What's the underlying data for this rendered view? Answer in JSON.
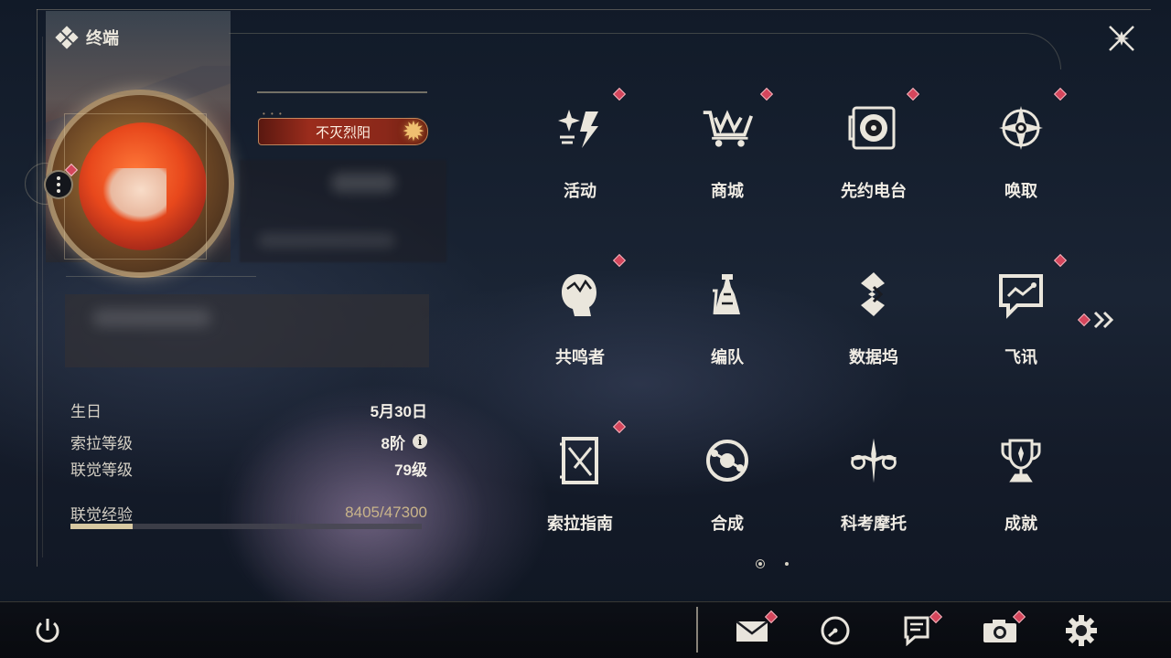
{
  "header": {
    "title": "终端",
    "title_icon": "diamond-cluster-icon",
    "close_icon": "close-x-icon"
  },
  "profile": {
    "title_badge": "不灭烈阳",
    "more_icon": "more-vertical-icon"
  },
  "info": {
    "birthday_label": "生日",
    "birthday_value": "5月30日",
    "sola_level_label": "索拉等级",
    "sola_level_value": "8阶",
    "union_level_label": "联觉等级",
    "union_level_value": "79级",
    "union_exp_label": "联觉经验",
    "union_exp_value": "8405/47300",
    "union_exp_current": 8405,
    "union_exp_max": 47300
  },
  "menu": {
    "items": [
      {
        "label": "活动",
        "icon": "events-sparkle-icon",
        "badge": true
      },
      {
        "label": "商城",
        "icon": "shop-cart-icon",
        "badge": true
      },
      {
        "label": "先约电台",
        "icon": "radio-record-icon",
        "badge": true
      },
      {
        "label": "唤取",
        "icon": "convene-compass-icon",
        "badge": true
      },
      {
        "label": "共鸣者",
        "icon": "resonator-head-icon",
        "badge": true
      },
      {
        "label": "编队",
        "icon": "team-chess-icon",
        "badge": false
      },
      {
        "label": "数据坞",
        "icon": "data-bank-icon",
        "badge": false
      },
      {
        "label": "飞讯",
        "icon": "message-chat-icon",
        "badge": true
      },
      {
        "label": "索拉指南",
        "icon": "guidebook-icon",
        "badge": true
      },
      {
        "label": "合成",
        "icon": "synthesis-icon",
        "badge": false
      },
      {
        "label": "科考摩托",
        "icon": "motorcycle-icon",
        "badge": false
      },
      {
        "label": "成就",
        "icon": "trophy-icon",
        "badge": false
      }
    ],
    "next_page_icon": "double-chevron-right-icon",
    "current_page": 1,
    "total_pages": 2
  },
  "bottom_bar": {
    "power_icon": "power-icon",
    "mail_icon": "mail-icon",
    "clock_icon": "timer-clock-icon",
    "notes_icon": "notice-board-icon",
    "camera_icon": "camera-icon",
    "settings_icon": "gear-icon"
  },
  "colors": {
    "accent_red": "#d5465c",
    "exp_bar": "#d8c9a2",
    "badge_bg": "#9a2c1c"
  }
}
